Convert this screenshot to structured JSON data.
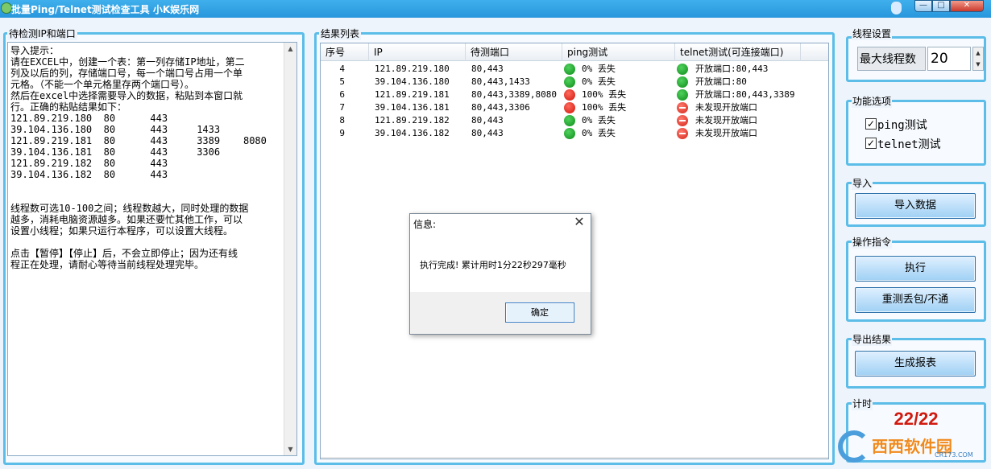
{
  "window": {
    "title": "批量Ping/Telnet测试检查工具 小K娱乐网",
    "min": "—",
    "max": "□",
    "close": "✕"
  },
  "left": {
    "label": "待检测IP和端口",
    "text": "导入提示：\n请在EXCEL中，创建一个表：第一列存储IP地址，第二\n列及以后的列，存储端口号，每一个端口号占用一个单\n元格。（不能一个单元格里存两个端口号）。\n然后在excel中选择需要导入的数据，粘贴到本窗口就\n行。正确的粘贴结果如下：\n121.89.219.180  80      443\n39.104.136.180  80      443     1433\n121.89.219.181  80      443     3389    8080\n39.104.136.181  80      443     3306\n121.89.219.182  80      443\n39.104.136.182  80      443\n\n\n线程数可选10-100之间；线程数越大，同时处理的数据\n越多，消耗电脑资源越多。如果还要忙其他工作，可以\n设置小线程；如果只运行本程序，可以设置大线程。\n\n点击【暂停】【停止】后，不会立即停止；因为还有线\n程正在处理，请耐心等待当前线程处理完毕。"
  },
  "results": {
    "label": "结果列表",
    "headers": [
      "序号",
      "IP",
      "待测端口",
      "ping测试",
      "telnet测试(可连接端口)"
    ],
    "rows": [
      {
        "no": "4",
        "ip": "121.89.219.180",
        "ports": "80,443",
        "ping": "0% 丢失",
        "ping_status": "green",
        "telnet": "开放端口:80,443",
        "telnet_status": "green"
      },
      {
        "no": "5",
        "ip": "39.104.136.180",
        "ports": "80,443,1433",
        "ping": "0% 丢失",
        "ping_status": "green",
        "telnet": "开放端口:80",
        "telnet_status": "green"
      },
      {
        "no": "6",
        "ip": "121.89.219.181",
        "ports": "80,443,3389,8080",
        "ping": "100% 丢失",
        "ping_status": "red",
        "telnet": "开放端口:80,443,3389",
        "telnet_status": "green"
      },
      {
        "no": "7",
        "ip": "39.104.136.181",
        "ports": "80,443,3306",
        "ping": "100% 丢失",
        "ping_status": "red",
        "telnet": "未发现开放端口",
        "telnet_status": "stop"
      },
      {
        "no": "8",
        "ip": "121.89.219.182",
        "ports": "80,443",
        "ping": "0% 丢失",
        "ping_status": "green",
        "telnet": "未发现开放端口",
        "telnet_status": "stop"
      },
      {
        "no": "9",
        "ip": "39.104.136.182",
        "ports": "80,443",
        "ping": "0% 丢失",
        "ping_status": "green",
        "telnet": "未发现开放端口",
        "telnet_status": "stop"
      }
    ]
  },
  "thread": {
    "label": "线程设置",
    "max_label": "最大线程数",
    "value": "20",
    "spin_up": "▲",
    "spin_down": "▼"
  },
  "functions": {
    "label": "功能选项",
    "ping_label": "ping测试",
    "ping_checked": true,
    "telnet_label": "telnet测试",
    "telnet_checked": true,
    "check_mark": "✓"
  },
  "import": {
    "label": "导入",
    "button": "导入数据"
  },
  "operations": {
    "label": "操作指令",
    "execute": "执行",
    "retest": "重测丢包/不通"
  },
  "export": {
    "label": "导出结果",
    "button": "生成报表"
  },
  "timer": {
    "label": "计时",
    "value": "22/22"
  },
  "watermark": {
    "text": "西西软件园",
    "sub": "CR173.COM"
  },
  "dialog": {
    "title": "信息:",
    "close": "✕",
    "message": "执行完成! 累计用时1分22秒297毫秒",
    "ok": "确定"
  },
  "scroll": {
    "up": "▲",
    "down": "▼"
  },
  "colors": {
    "accent": "#5bbde8",
    "titlebar": "#2896dc",
    "timer": "#d11a0f"
  }
}
